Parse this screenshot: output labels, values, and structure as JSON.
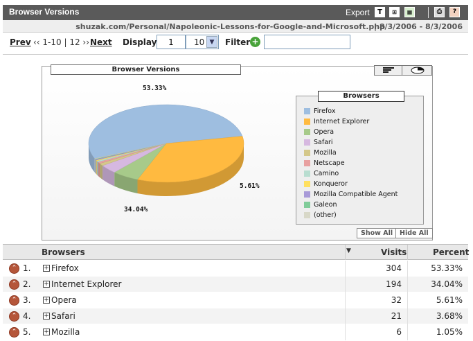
{
  "window": {
    "title": "Browser Versions",
    "export_label": "Export"
  },
  "url_bar": {
    "url": "shuzak.com/Personal/Napoleonic-Lessons-for-Google-and-Microsoft.php",
    "dates": "| 8/3/2006 - 8/3/2006"
  },
  "pager": {
    "prev_label": "Prev",
    "range_label": "‹‹ 1-10 | 12 ››",
    "next_label": "Next",
    "display_label": "Display",
    "display_start": "1",
    "display_count": "10",
    "filter_label": "Filter",
    "filter_value": ""
  },
  "chart_panel": {
    "title": "Browser Versions",
    "legend_title": "Browsers",
    "show_all_label": "Show All",
    "hide_all_label": "Hide All",
    "pct_firefox": "53.33%",
    "pct_ie": "34.04%",
    "pct_opera": "5.61%"
  },
  "chart_data": {
    "type": "pie",
    "title": "Browser Versions",
    "legend_title": "Browsers",
    "categories": [
      "Firefox",
      "Internet Explorer",
      "Opera",
      "Safari",
      "Mozilla",
      "Netscape",
      "Camino",
      "Konqueror",
      "Mozilla Compatible Agent",
      "Galeon",
      "(other)"
    ],
    "values": [
      53.33,
      34.04,
      5.61,
      3.68,
      1.05,
      0.7,
      0.53,
      0.35,
      0.35,
      0.18,
      0.18
    ],
    "colors": [
      "#9ebee0",
      "#ffba40",
      "#a7ca8a",
      "#d6b8e0",
      "#d4c88a",
      "#e8a0a0",
      "#b8ddd0",
      "#ffe060",
      "#a89ad8",
      "#80cc99",
      "#d8d8c8"
    ],
    "slice_labels_shown": [
      "53.33%",
      "34.04%",
      "5.61%"
    ],
    "legend_placement": "right"
  },
  "table": {
    "col_browsers": "Browsers",
    "col_visits": "Visits",
    "col_percent": "Percent",
    "rows": [
      {
        "rank": "1.",
        "name": "Firefox",
        "visits": "304",
        "percent": "53.33%"
      },
      {
        "rank": "2.",
        "name": "Internet Explorer",
        "visits": "194",
        "percent": "34.04%"
      },
      {
        "rank": "3.",
        "name": "Opera",
        "visits": "32",
        "percent": "5.61%"
      },
      {
        "rank": "4.",
        "name": "Safari",
        "visits": "21",
        "percent": "3.68%"
      },
      {
        "rank": "5.",
        "name": "Mozilla",
        "visits": "6",
        "percent": "1.05%"
      }
    ]
  }
}
